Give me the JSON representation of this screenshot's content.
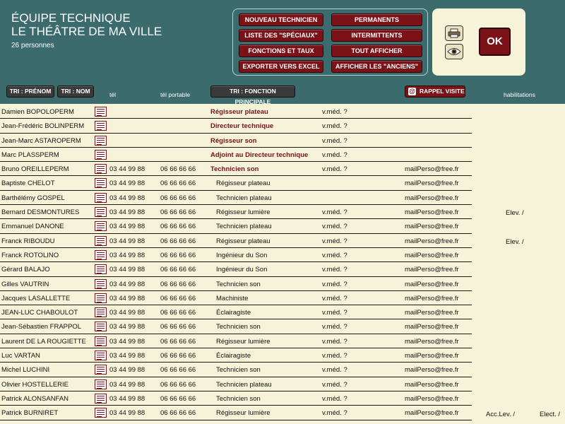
{
  "header": {
    "title_line1": "ÉQUIPE TECHNIQUE",
    "title_line2": "LE THÉÂTRE DE MA VILLE",
    "count": "26 personnes"
  },
  "actions": {
    "nouveau": "NOUVEAU TECHNICIEN",
    "permanents": "PERMANENTS",
    "speciaux": "LISTE DES \"SPÉCIAUX\"",
    "intermittents": "INTERMITTENTS",
    "fonctions": "FONCTIONS ET TAUX",
    "tout": "TOUT AFFICHER",
    "exporter": "EXPORTER VERS EXCEL",
    "anciens": "AFFICHER LES \"ANCIENS\"",
    "ok": "OK"
  },
  "columns": {
    "tri_prenom": "TRI : PRÉNOM",
    "tri_nom": "TRI : NOM",
    "tel": "tél",
    "tel_portable": "tél portable",
    "tri_fonction": "TRI : FONCTION PRINCIPALE",
    "rappel": "RAPPEL VISITE",
    "habilitations": "habilitations"
  },
  "colors": {
    "header_bg": "#3b6b6c",
    "accent": "#7a1218",
    "body_bg": "#f7f3d9"
  },
  "rows": [
    {
      "name": "Damien BOPOLOPERM",
      "tel": "",
      "port": "",
      "func": "Régisseur plateau",
      "perm": true,
      "vmed": "v.méd. ?",
      "mail": ""
    },
    {
      "name": "Jean-Frédéric BOLINPERM",
      "tel": "",
      "port": "",
      "func": "Directeur technique",
      "perm": true,
      "vmed": "v.méd. ?",
      "mail": ""
    },
    {
      "name": "Jean-Marc ASTAROPERM",
      "tel": "",
      "port": "",
      "func": "Régisseur son",
      "perm": true,
      "vmed": "v.méd. ?",
      "mail": ""
    },
    {
      "name": "Marc PLASSPERM",
      "tel": "",
      "port": "",
      "func": "Adjoint au Directeur technique",
      "perm": true,
      "vmed": "v.méd. ?",
      "mail": ""
    },
    {
      "name": "Bruno OREILLEPERM",
      "tel": "03 44 99 88",
      "port": "06 66 66 66",
      "func": "Technicien son",
      "perm": true,
      "vmed": "v.méd. ?",
      "mail": "mailPerso@free.fr"
    },
    {
      "name": "Baptiste CHELOT",
      "tel": "03 44 99 88",
      "port": "06 66 66 66",
      "func": "Régisseur plateau",
      "perm": false,
      "vmed": "",
      "mail": "mailPerso@free.fr"
    },
    {
      "name": "Barthélémy GOSPEL",
      "tel": "03 44 99 88",
      "port": "06 66 66 66",
      "func": "Technicien plateau",
      "perm": false,
      "vmed": "",
      "mail": "mailPerso@free.fr"
    },
    {
      "name": "Bernard DESMONTURES",
      "tel": "03 44 99 88",
      "port": "06 66 66 66",
      "func": "Régisseur lumière",
      "perm": false,
      "vmed": "v.méd. ?",
      "mail": "mailPerso@free.fr"
    },
    {
      "name": "Emmanuel DANONE",
      "tel": "03 44 99 88",
      "port": "06 66 66 66",
      "func": "Technicien plateau",
      "perm": false,
      "vmed": "v.méd. ?",
      "mail": "mailPerso@free.fr"
    },
    {
      "name": "Franck RIBOUDU",
      "tel": "03 44 99 88",
      "port": "06 66 66 66",
      "func": "Régisseur plateau",
      "perm": false,
      "vmed": "v.méd. ?",
      "mail": "mailPerso@free.fr"
    },
    {
      "name": "Franck ROTOLINO",
      "tel": "03 44 99 88",
      "port": "06 66 66 66",
      "func": "Ingénieur du Son",
      "perm": false,
      "vmed": "v.méd. ?",
      "mail": "mailPerso@free.fr"
    },
    {
      "name": "Gérard BALAJO",
      "tel": "03 44 99 88",
      "port": "06 66 66 66",
      "func": "Ingénieur du Son",
      "perm": false,
      "vmed": "v.méd. ?",
      "mail": "mailPerso@free.fr"
    },
    {
      "name": "Gilles VAUTRIN",
      "tel": "03 44 99 88",
      "port": "06 66 66 66",
      "func": "Technicien son",
      "perm": false,
      "vmed": "v.méd. ?",
      "mail": "mailPerso@free.fr"
    },
    {
      "name": "Jacques LASALLETTE",
      "tel": "03 44 99 88",
      "port": "06 66 66 66",
      "func": "Machiniste",
      "perm": false,
      "vmed": "v.méd. ?",
      "mail": "mailPerso@free.fr"
    },
    {
      "name": "JEAN-LUC CHABOULOT",
      "tel": "03 44 99 88",
      "port": "06 66 66 66",
      "func": "Éclairagiste",
      "perm": false,
      "vmed": "v.méd. ?",
      "mail": "mailPerso@free.fr"
    },
    {
      "name": "Jean-Sébastien FRAPPOL",
      "tel": "03 44 99 88",
      "port": "06 66 66 66",
      "func": "Technicien son",
      "perm": false,
      "vmed": "v.méd. ?",
      "mail": "mailPerso@free.fr"
    },
    {
      "name": "Laurent DE LA ROUGIETTE",
      "tel": "03 44 99 88",
      "port": "06 66 66 66",
      "func": "Régisseur lumière",
      "perm": false,
      "vmed": "v.méd. ?",
      "mail": "mailPerso@free.fr"
    },
    {
      "name": "Luc VARTAN",
      "tel": "03 44 99 88",
      "port": "06 66 66 66",
      "func": "Éclairagiste",
      "perm": false,
      "vmed": "v.méd. ?",
      "mail": "mailPerso@free.fr"
    },
    {
      "name": "Michel LUCHINI",
      "tel": "03 44 99 88",
      "port": "06 66 66 66",
      "func": "Technicien son",
      "perm": false,
      "vmed": "v.méd. ?",
      "mail": "mailPerso@free.fr"
    },
    {
      "name": "Olivier HOSTELLERIE",
      "tel": "03 44 99 88",
      "port": "06 66 66 66",
      "func": "Technicien plateau",
      "perm": false,
      "vmed": "v.méd. ?",
      "mail": "mailPerso@free.fr"
    },
    {
      "name": "Patrick ALONSANFAN",
      "tel": "03 44 99 88",
      "port": "06 66 66 66",
      "func": "Technicien son",
      "perm": false,
      "vmed": "v.méd. ?",
      "mail": "mailPerso@free.fr"
    },
    {
      "name": "Patrick BURNIRET",
      "tel": "03 44 99 88",
      "port": "06 66 66 66",
      "func": "Régisseur lumière",
      "perm": false,
      "vmed": "v.méd. ?",
      "mail": "mailPerso@free.fr"
    }
  ],
  "habilitations": {
    "bernard": "Elev. /",
    "franck": "Elev. /",
    "patrick_1": "Acc.Lev. /",
    "patrick_2": "Elect. /"
  }
}
